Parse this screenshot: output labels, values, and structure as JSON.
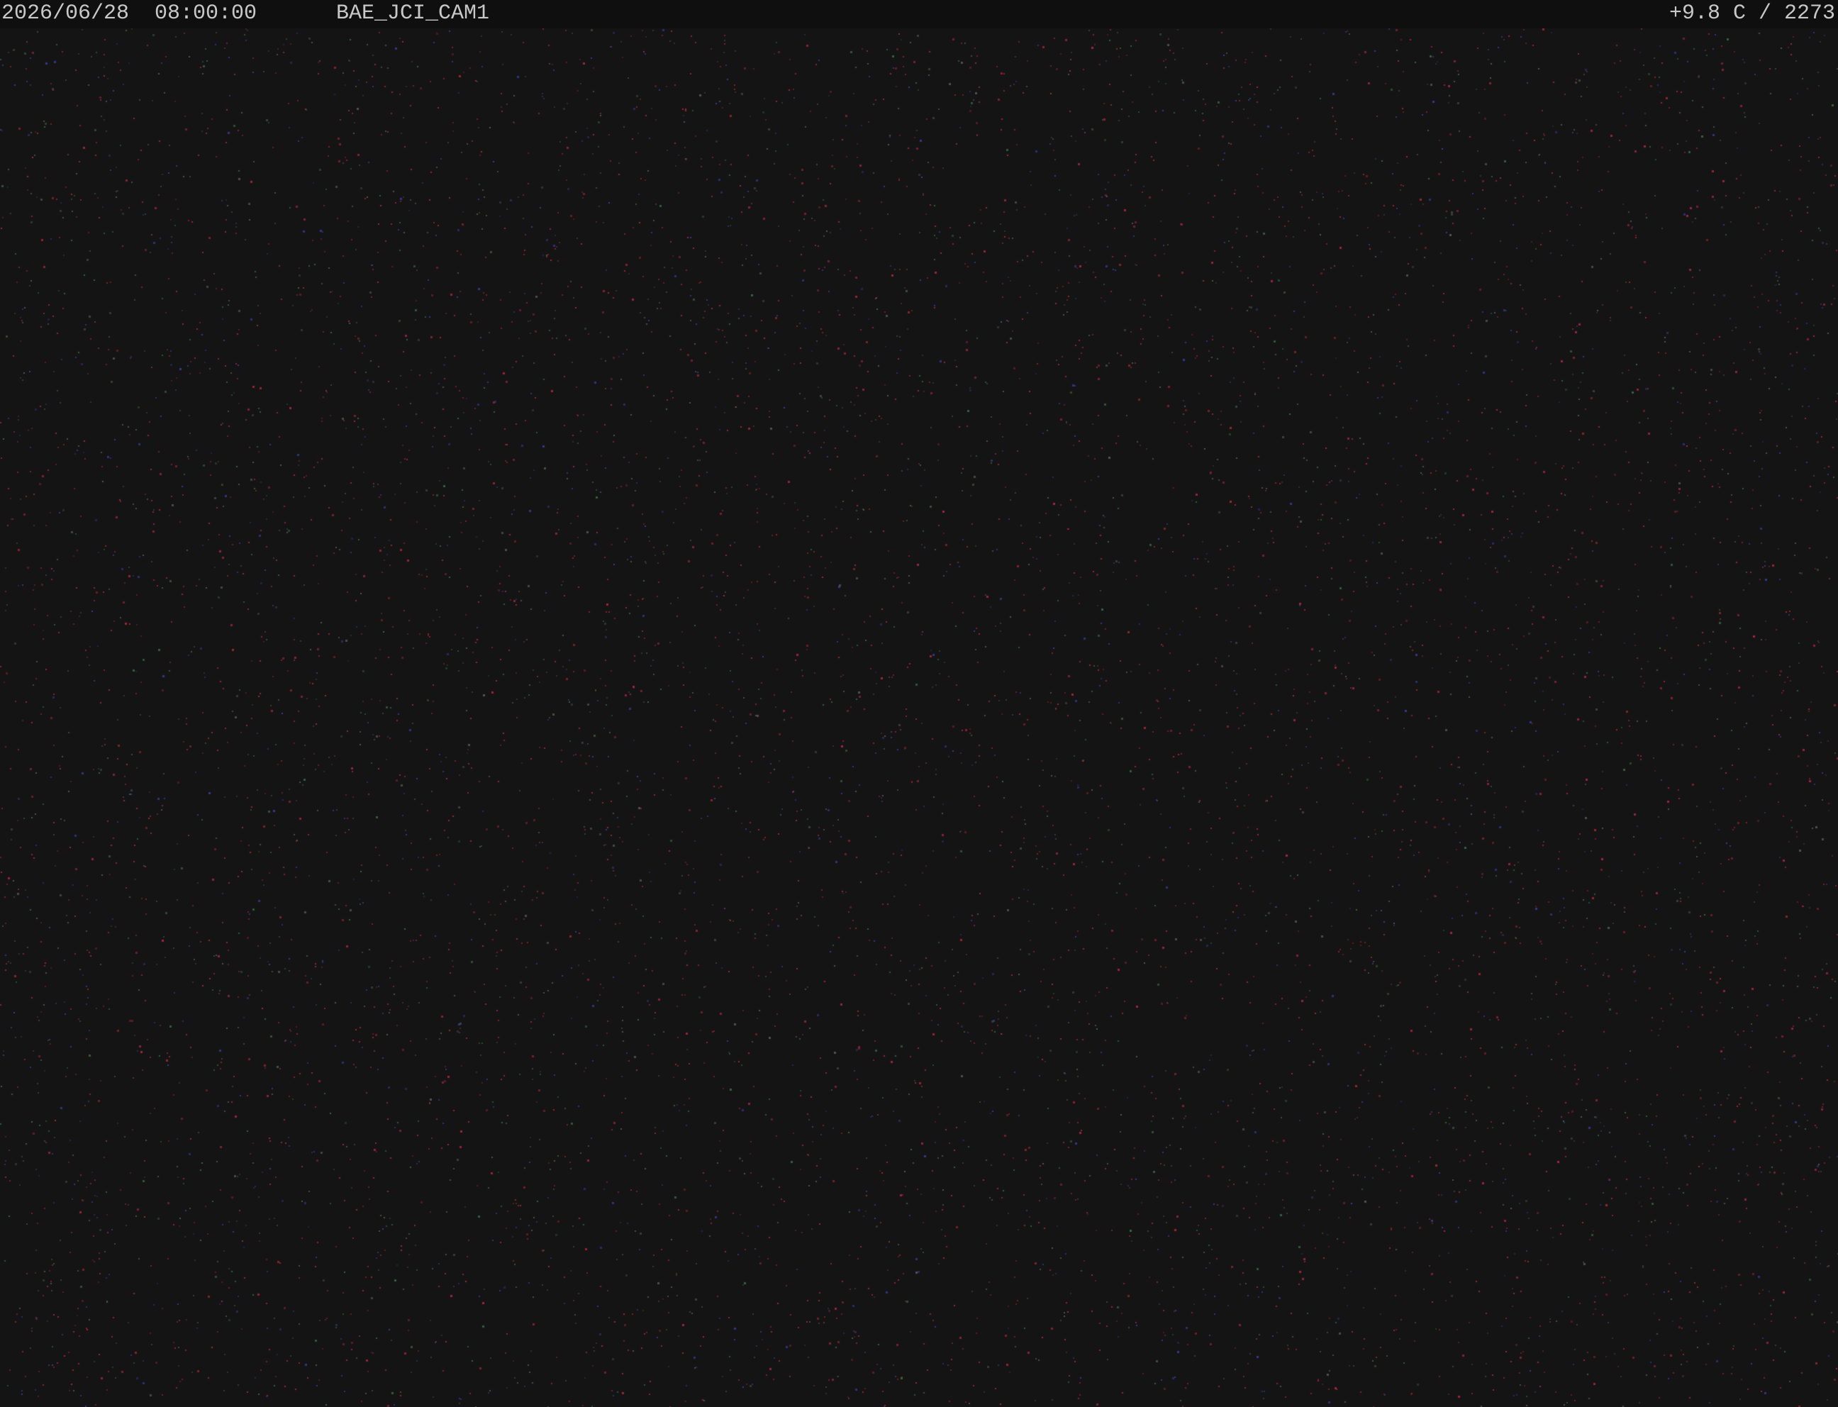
{
  "osd": {
    "datetime": "2026/06/28  08:00:00",
    "camera": "BAE_JCI_CAM1",
    "reading": "+9.8 C / 2273"
  },
  "colors": {
    "background": "#141414",
    "overlay_bar": "#0f0f0f",
    "overlay_text": "#c8c8c8",
    "noise_red": "#b0283c",
    "noise_green": "#3c6e46",
    "noise_blue": "#3c3ca0"
  }
}
